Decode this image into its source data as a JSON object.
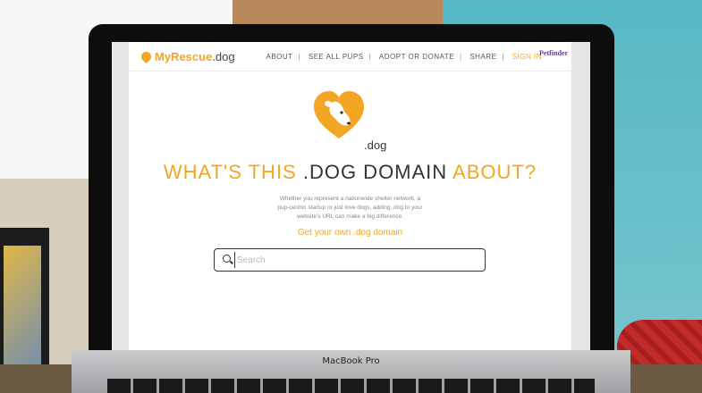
{
  "header": {
    "brand": "MyRescue",
    "brand_suffix": ".dog",
    "nav": [
      "ABOUT",
      "SEE ALL PUPS",
      "ADOPT OR DONATE",
      "SHARE",
      "SIGN IN"
    ],
    "partner": "Petfinder"
  },
  "hero": {
    "logo_suffix": ".dog",
    "title_part1": "WHAT'S THIS ",
    "title_part2": ".DOG DOMAIN",
    "title_part3": " ABOUT?",
    "description": "Whether you represent a nationwide shelter network, a pup-centric startup or just love dogs, adding .dog to your website's URL can make a big difference.",
    "cta": "Get your own .dog domain"
  },
  "search": {
    "placeholder": "Search"
  },
  "laptop": {
    "label": "MacBook Pro"
  },
  "colors": {
    "accent": "#f2a623"
  }
}
